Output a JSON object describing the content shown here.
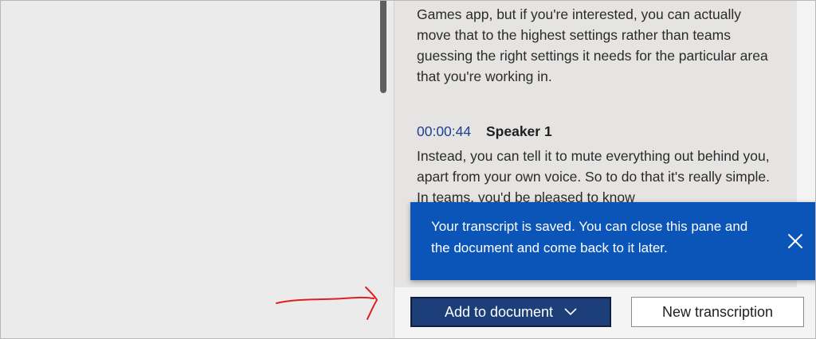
{
  "transcript": {
    "para1": "Games app, but if you're interested, you can actually move that to the highest settings rather than teams guessing the right settings it needs for the particular area that you're working in.",
    "segment": {
      "timestamp": "00:00:44",
      "speaker": "Speaker 1",
      "text": "Instead, you can tell it to mute everything out behind you, apart from your own voice. So to do that it's really simple. In teams, you'd be pleased to know"
    }
  },
  "toast": {
    "message": "Your transcript is saved. You can close this pane and the document and come back to it later.",
    "close_icon": "close-icon"
  },
  "footer": {
    "add_label": "Add to document",
    "new_label": "New transcription"
  },
  "colors": {
    "toast_bg": "#0b55b8",
    "primary_button": "#1c3f7a",
    "timestamp": "#1f3f8f",
    "annotation": "#e02020"
  }
}
